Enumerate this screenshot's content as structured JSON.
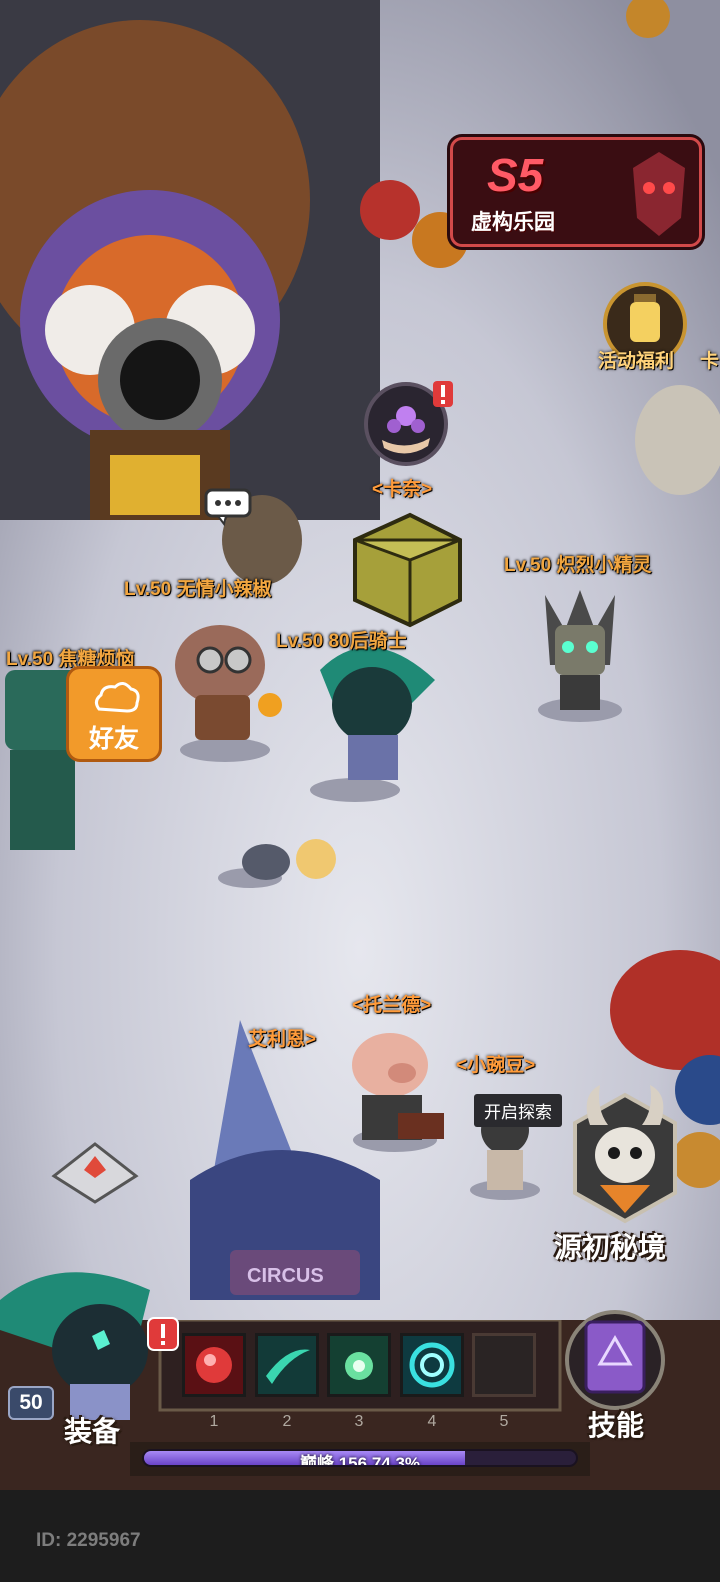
{
  "season": {
    "number": "S5",
    "name": "虚构乐园"
  },
  "event_button": {
    "label": "活动福利",
    "edge_label": "卡"
  },
  "players": [
    {
      "level_name": "Lv.50 无情小辣椒"
    },
    {
      "level_name": "Lv.50 80后骑士"
    },
    {
      "level_name": "Lv.50 焦糖烦恼"
    },
    {
      "level_name": "Lv.50 炽烈小精灵"
    }
  ],
  "npcs": {
    "kana": "<卡奈>",
    "torand": "<托兰德>",
    "xiaowandou": "<小豌豆>",
    "ailien": "艾利恩>"
  },
  "friend_button": {
    "label": "好友"
  },
  "explore_tip": "开启探索",
  "dungeon_button": {
    "label": "源初秘境"
  },
  "hero": {
    "level": "50",
    "equip_label": "装备"
  },
  "skills": {
    "label": "技能",
    "slots": [
      {
        "number": "1",
        "icon": "red-orb-icon",
        "color": "#c8262e"
      },
      {
        "number": "2",
        "icon": "green-slash-icon",
        "color": "#1f8f7a"
      },
      {
        "number": "3",
        "icon": "green-spore-icon",
        "color": "#2c9a6a"
      },
      {
        "number": "4",
        "icon": "cyan-vortex-icon",
        "color": "#1aa4a4"
      },
      {
        "number": "5",
        "icon": "empty-slot",
        "color": "#2a2424"
      }
    ]
  },
  "xp_bar": {
    "label": "巅峰",
    "level": "156",
    "percent_text": "74.3%",
    "fraction": 0.743
  },
  "player_id": "ID: 2295967"
}
